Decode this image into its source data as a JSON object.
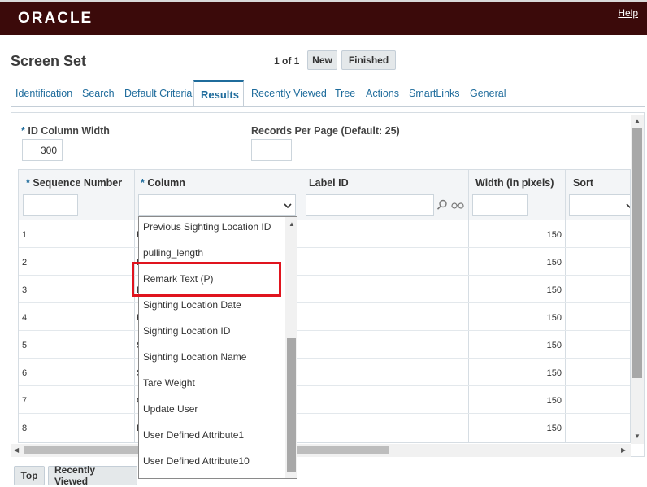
{
  "header": {
    "logo": "ORACLE",
    "help": "Help"
  },
  "page": {
    "title": "Screen Set",
    "pager": "1 of 1",
    "new_label": "New",
    "finished_label": "Finished"
  },
  "tabs": [
    {
      "label": "Identification"
    },
    {
      "label": "Search"
    },
    {
      "label": "Default Criteria"
    },
    {
      "label": "Results"
    },
    {
      "label": "Recently Viewed"
    },
    {
      "label": "Tree"
    },
    {
      "label": "Actions"
    },
    {
      "label": "SmartLinks"
    },
    {
      "label": "General"
    }
  ],
  "form": {
    "required_mark": "*",
    "id_column_width_label": "ID Column Width",
    "id_column_width_value": "300",
    "records_per_page_label": "Records Per Page (Default: 25)",
    "records_per_page_value": ""
  },
  "grid": {
    "columns": [
      "Sequence Number",
      "Column",
      "Label ID",
      "Width (in pixels)",
      "Sort"
    ],
    "rows": [
      {
        "seq": "1",
        "clip": "F",
        "width": "150"
      },
      {
        "seq": "2",
        "clip": "F",
        "width": "150"
      },
      {
        "seq": "3",
        "clip": "D",
        "width": "150"
      },
      {
        "seq": "4",
        "clip": "F",
        "width": "150"
      },
      {
        "seq": "5",
        "clip": "S",
        "width": "150"
      },
      {
        "seq": "6",
        "clip": "S",
        "width": "150"
      },
      {
        "seq": "7",
        "clip": "C",
        "width": "150"
      },
      {
        "seq": "8",
        "clip": "F",
        "width": "150"
      }
    ]
  },
  "dropdown": {
    "options": [
      "Previous Sighting Location ID",
      "pulling_length",
      "Remark Text (P)",
      "Sighting Location Date",
      "Sighting Location ID",
      "Sighting Location Name",
      "Tare Weight",
      "Update User",
      "User Defined Attribute1",
      "User Defined Attribute10"
    ],
    "highlighted": "Remark Text (P)"
  },
  "footer": {
    "top_label": "Top",
    "recently_viewed_label": "Recently Viewed"
  },
  "colors": {
    "header_bg": "#3b0a0a",
    "accent": "#1f6c9c",
    "highlight": "#e0141e"
  }
}
